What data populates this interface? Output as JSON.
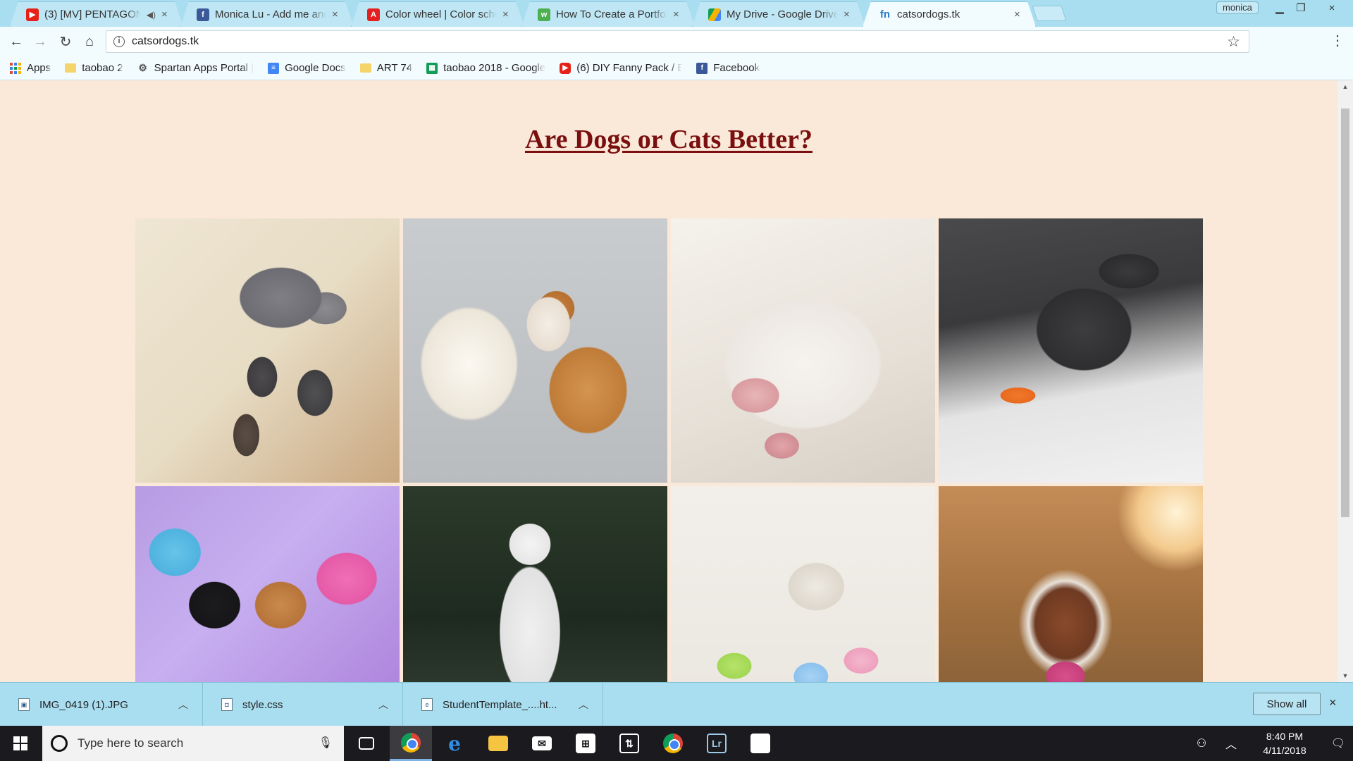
{
  "window": {
    "tabs": [
      {
        "title": "(3) [MV] PENTAGON(",
        "favicon": "youtube-icon",
        "color": "#e62117",
        "audio": true,
        "active": false
      },
      {
        "title": "Monica Lu - Add me and",
        "favicon": "facebook-icon",
        "color": "#3b5998",
        "audio": false,
        "active": false
      },
      {
        "title": "Color wheel | Color scher",
        "favicon": "adobe-icon",
        "color": "#e41f1f",
        "audio": false,
        "active": false
      },
      {
        "title": "How To Create a Portfoli",
        "favicon": "w3schools-icon",
        "color": "#4caf50",
        "audio": false,
        "active": false
      },
      {
        "title": "My Drive - Google Drive",
        "favicon": "google-drive-icon",
        "color": "#f4b400",
        "audio": false,
        "active": false
      },
      {
        "title": "catsordogs.tk",
        "favicon": "freenom-icon",
        "color": "#2a7ac6",
        "audio": false,
        "active": true
      }
    ],
    "profile_name": "monica",
    "close_glyph": "×"
  },
  "toolbar": {
    "url": "catsordogs.tk"
  },
  "bookmarks": [
    {
      "label": "Apps",
      "icon": "apps-grid-icon"
    },
    {
      "label": "taobao 2",
      "icon": "folder-icon"
    },
    {
      "label": "Spartan Apps Portal |",
      "icon": "spartan-icon"
    },
    {
      "label": "Google Docs",
      "icon": "google-docs-icon"
    },
    {
      "label": "ART 74",
      "icon": "folder-icon"
    },
    {
      "label": "taobao 2018 - Google",
      "icon": "google-sheets-icon"
    },
    {
      "label": "(6) DIY Fanny Pack / E",
      "icon": "youtube-icon"
    },
    {
      "label": "Facebook",
      "icon": "facebook-icon"
    }
  ],
  "page": {
    "title": "Are Dogs or Cats Better?",
    "background": "#fae9d8",
    "title_color": "#7a0f0f",
    "photos": [
      {
        "subject": "cat-with-kittens"
      },
      {
        "subject": "corgi-on-fur-blanket"
      },
      {
        "subject": "white-cat-closeup"
      },
      {
        "subject": "french-bulldog-with-carrot-toy"
      },
      {
        "subject": "chimera-cat-with-peeps"
      },
      {
        "subject": "white-shepherd-and-puppy"
      },
      {
        "subject": "cat-with-bunny-ears-and-eggs"
      },
      {
        "subject": "australian-shepherd-licking"
      }
    ]
  },
  "downloads": {
    "items": [
      {
        "filename": "IMG_0419 (1).JPG"
      },
      {
        "filename": "style.css"
      },
      {
        "filename": "StudentTemplate_....ht..."
      }
    ],
    "show_all_label": "Show all"
  },
  "taskbar": {
    "search_placeholder": "Type here to search",
    "apps": [
      "chrome-icon",
      "edge-icon",
      "file-explorer-icon",
      "mail-icon",
      "store-icon",
      "remote-desktop-icon",
      "chrome-icon",
      "lightroom-icon",
      "sticky-notes-icon"
    ],
    "time": "8:40 PM",
    "date": "4/11/2018"
  }
}
